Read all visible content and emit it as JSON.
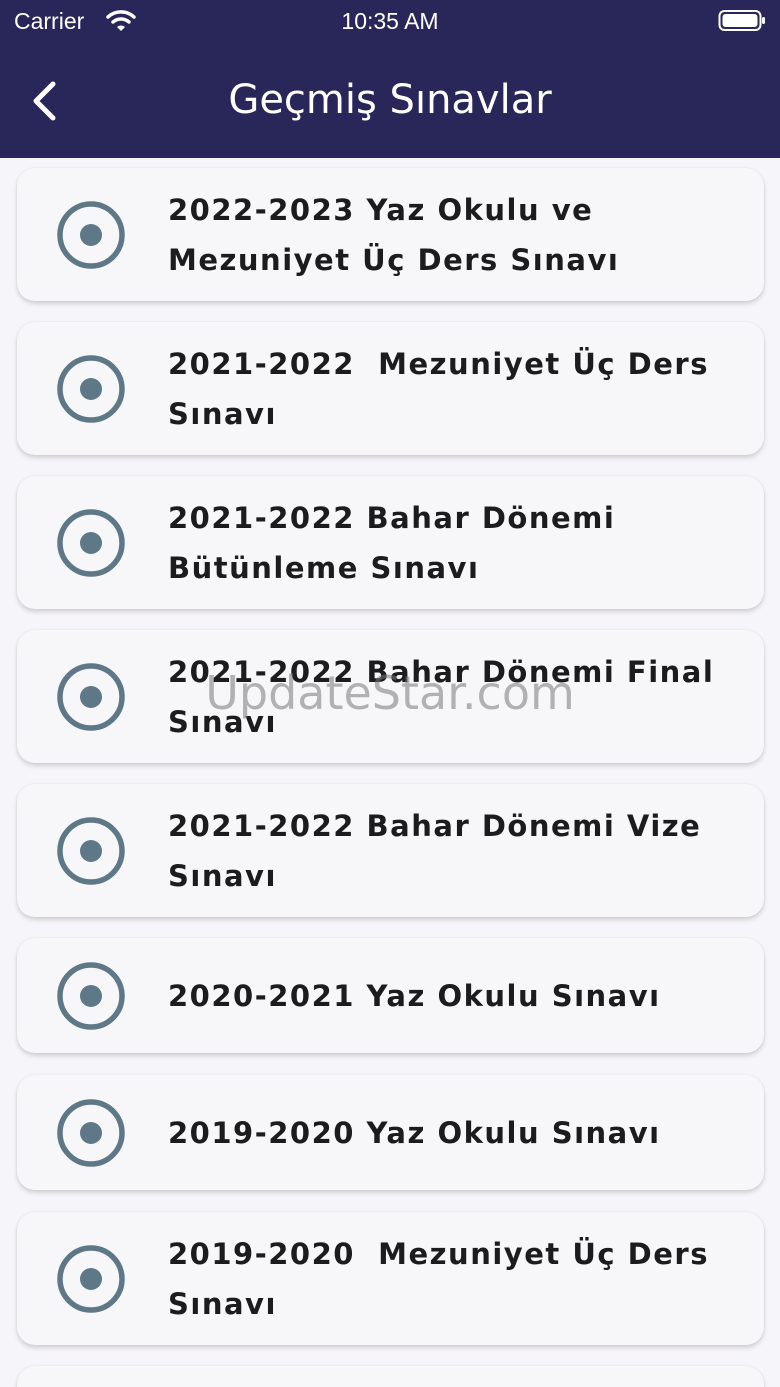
{
  "status_bar": {
    "carrier": "Carrier",
    "time": "10:35 AM"
  },
  "header": {
    "title": "Geçmiş Sınavlar"
  },
  "exams": [
    {
      "label": "2022-2023 Yaz Okulu ve Mezuniyet Üç Ders Sınavı"
    },
    {
      "label": "2021-2022  Mezuniyet Üç Ders Sınavı"
    },
    {
      "label": "2021-2022 Bahar Dönemi Bütünleme Sınavı"
    },
    {
      "label": "2021-2022 Bahar Dönemi Final Sınavı"
    },
    {
      "label": "2021-2022 Bahar Dönemi Vize Sınavı"
    },
    {
      "label": "2020-2021 Yaz Okulu Sınavı"
    },
    {
      "label": "2019-2020 Yaz Okulu Sınavı"
    },
    {
      "label": "2019-2020  Mezuniyet Üç Ders Sınavı"
    }
  ],
  "watermark": "UpdateStar.com",
  "colors": {
    "header_bg": "#29265a",
    "radio": "#5f7887",
    "card_bg": "#f7f7fa"
  },
  "icons": {
    "back": "chevron-left-icon",
    "radio": "radio-selected-icon"
  }
}
